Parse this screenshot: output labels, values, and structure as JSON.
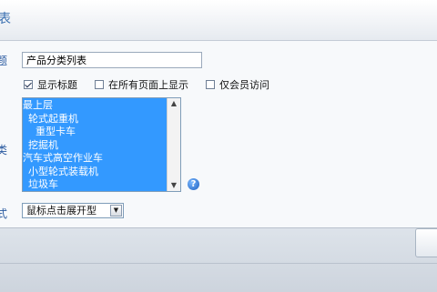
{
  "window": {
    "title": "表"
  },
  "form": {
    "title_label": "题",
    "title_value": "产品分类列表",
    "checkboxes": [
      {
        "label": "显示标题",
        "checked": true
      },
      {
        "label": "在所有页面上显示",
        "checked": false
      },
      {
        "label": "仅会员访问",
        "checked": false
      }
    ],
    "category_label": "类",
    "categories": [
      "最上层",
      "  轮式起重机",
      "    重型卡车",
      "  挖掘机",
      "汽车式高空作业车",
      "  小型轮式装载机",
      "  垃圾车"
    ],
    "help_glyph": "?",
    "style_label": "式",
    "style_value": "鼠标点击展开型"
  }
}
